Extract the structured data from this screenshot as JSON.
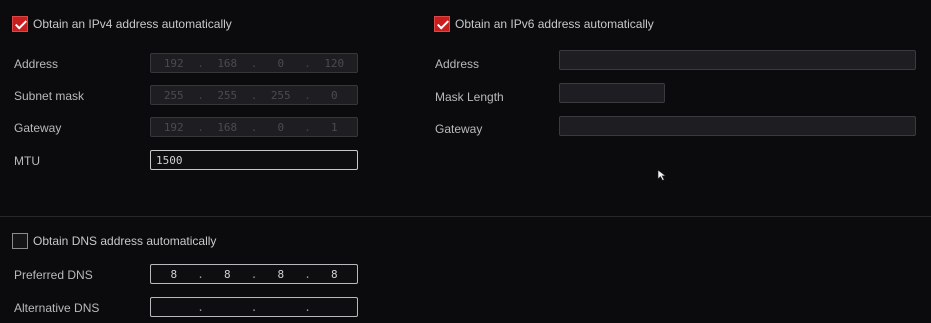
{
  "ipv4": {
    "auto_label": "Obtain an IPv4 address automatically",
    "auto_checked": true,
    "address_label": "Address",
    "address": [
      "192",
      "168",
      "0",
      "120"
    ],
    "subnet_label": "Subnet mask",
    "subnet": [
      "255",
      "255",
      "255",
      "0"
    ],
    "gateway_label": "Gateway",
    "gateway": [
      "192",
      "168",
      "0",
      "1"
    ],
    "mtu_label": "MTU",
    "mtu": "1500"
  },
  "ipv6": {
    "auto_label": "Obtain an IPv6 address automatically",
    "auto_checked": true,
    "address_label": "Address",
    "address": "",
    "mask_label": "Mask Length",
    "mask": "",
    "gateway_label": "Gateway",
    "gateway": ""
  },
  "dns": {
    "auto_label": "Obtain DNS address automatically",
    "auto_checked": false,
    "preferred_label": "Preferred DNS",
    "preferred": [
      "8",
      "8",
      "8",
      "8"
    ],
    "alternative_label": "Alternative DNS",
    "alternative": [
      "",
      "",
      "",
      ""
    ]
  },
  "icons": {
    "checkbox_checked": "checkmark-icon",
    "cursor": "mouse-pointer-icon"
  },
  "colors": {
    "background": "#0b0b0d",
    "checkbox_accent": "#c81e1e",
    "text": "#c8c8cc"
  }
}
